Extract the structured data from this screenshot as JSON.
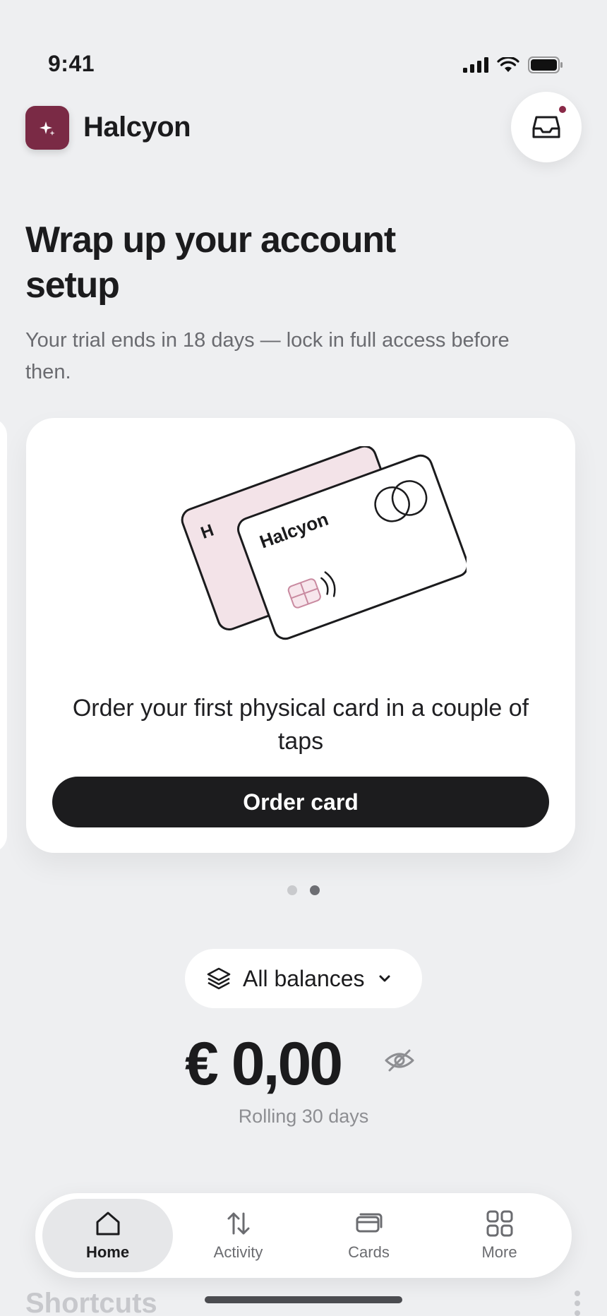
{
  "status_bar": {
    "time": "9:41"
  },
  "header": {
    "app_name": "Halcyon",
    "inbox_has_notification": true
  },
  "headline": {
    "title": "Wrap up your account setup",
    "subtitle": "Your trial ends in 18 days — lock in full access before then."
  },
  "promo_card": {
    "card_brand_front": "Halcyon",
    "card_brand_back": "H",
    "text": "Order your first physical card in a couple of taps",
    "button_label": "Order card"
  },
  "carousel": {
    "total": 2,
    "active_index": 1
  },
  "balances": {
    "selector_label": "All balances",
    "amount": "€ 0,00",
    "period": "Rolling 30 days"
  },
  "shortcuts": {
    "title": "Shortcuts"
  },
  "nav": {
    "items": [
      {
        "label": "Home",
        "icon": "home-icon",
        "active": true
      },
      {
        "label": "Activity",
        "icon": "activity-icon",
        "active": false
      },
      {
        "label": "Cards",
        "icon": "cards-icon",
        "active": false
      },
      {
        "label": "More",
        "icon": "grid-icon",
        "active": false
      }
    ]
  },
  "colors": {
    "accent": "#7a2a45",
    "primary_button": "#1c1c1e",
    "background": "#eeeff1"
  }
}
